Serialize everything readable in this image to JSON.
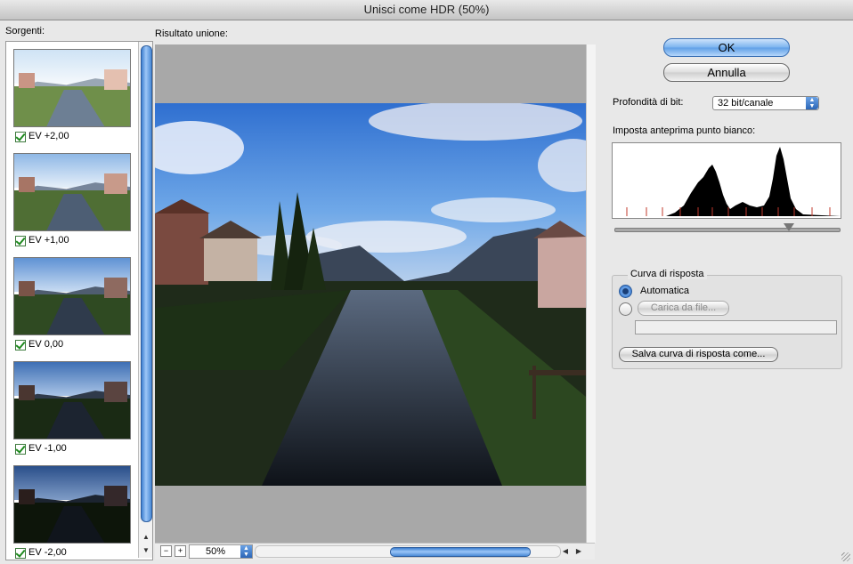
{
  "window": {
    "title": "Unisci come HDR (50%)"
  },
  "sources": {
    "label": "Sorgenti:",
    "items": [
      {
        "label": "EV +2,00",
        "checked": true
      },
      {
        "label": "EV +1,00",
        "checked": true
      },
      {
        "label": "EV 0,00",
        "checked": true
      },
      {
        "label": "EV -1,00",
        "checked": true
      },
      {
        "label": "EV -2,00",
        "checked": true
      }
    ]
  },
  "preview": {
    "label": "Risultato unione:",
    "zoom": "50%",
    "zoom_out_glyph": "−",
    "zoom_in_glyph": "+"
  },
  "buttons": {
    "ok": "OK",
    "cancel": "Annulla"
  },
  "bit_depth": {
    "label": "Profondità di bit:",
    "value": "32 bit/canale"
  },
  "white_point": {
    "label": "Imposta anteprima punto bianco:"
  },
  "response_curve": {
    "group_label": "Curva di risposta",
    "automatic_label": "Automatica",
    "automatic_selected": true,
    "load_button": "Carica da file...",
    "save_button": "Salva curva di risposta come..."
  }
}
